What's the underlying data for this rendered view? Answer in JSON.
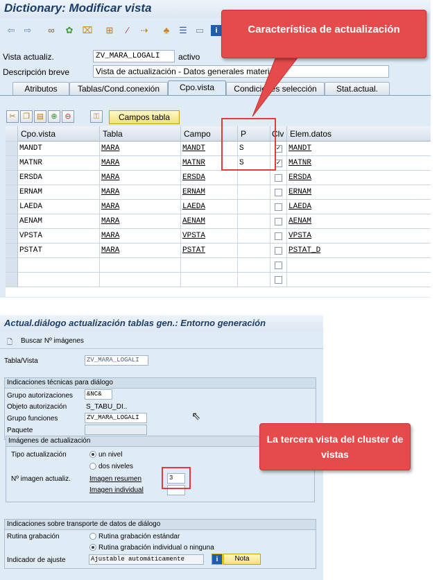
{
  "top_window": {
    "title": "Dictionary: Modificar vista",
    "fields": {
      "vista_label": "Vista actualiz.",
      "vista_value": "ZV_MARA_LOGALI",
      "vista_status": "activo",
      "desc_label": "Descripción breve",
      "desc_value": "Vista de actualización - Datos generales material"
    },
    "tabs": [
      "Atributos",
      "Tablas/Cond.conexión",
      "Cpo.vista",
      "Condiciones selección",
      "Stat.actual."
    ],
    "campos_tabla_button": "Campos tabla",
    "grid": {
      "headers": [
        "Cpo.vista",
        "Tabla",
        "Campo",
        "P",
        "Clv",
        "Elem.datos"
      ],
      "rows": [
        {
          "cpo": "MANDT",
          "tabla": "MARA",
          "campo": "MANDT",
          "p": "S",
          "clv": true,
          "elem": "MANDT"
        },
        {
          "cpo": "MATNR",
          "tabla": "MARA",
          "campo": "MATNR",
          "p": "S",
          "clv": true,
          "elem": "MATNR"
        },
        {
          "cpo": "ERSDA",
          "tabla": "MARA",
          "campo": "ERSDA",
          "p": "",
          "clv": false,
          "elem": "ERSDA"
        },
        {
          "cpo": "ERNAM",
          "tabla": "MARA",
          "campo": "ERNAM",
          "p": "",
          "clv": false,
          "elem": "ERNAM"
        },
        {
          "cpo": "LAEDA",
          "tabla": "MARA",
          "campo": "LAEDA",
          "p": "",
          "clv": false,
          "elem": "LAEDA"
        },
        {
          "cpo": "AENAM",
          "tabla": "MARA",
          "campo": "AENAM",
          "p": "",
          "clv": false,
          "elem": "AENAM"
        },
        {
          "cpo": "VPSTA",
          "tabla": "MARA",
          "campo": "VPSTA",
          "p": "",
          "clv": false,
          "elem": "VPSTA"
        },
        {
          "cpo": "PSTAT",
          "tabla": "MARA",
          "campo": "PSTAT",
          "p": "",
          "clv": false,
          "elem": "PSTAT_D"
        }
      ]
    }
  },
  "callout_top": "Característica de actualización",
  "bottom_window": {
    "title": "Actual.diálogo actualización tablas gen.: Entorno generación",
    "buscar_button": "Buscar Nº imágenes",
    "tabla_vista_label": "Tabla/Vista",
    "tabla_vista_value": "ZV_MARA_LOGALI",
    "tech_group": {
      "header": "Indicaciones técnicas para diálogo",
      "grupo_aut_label": "Grupo autorizaciones",
      "grupo_aut_value": "&NC&",
      "objeto_aut_label": "Objeto autorización",
      "objeto_aut_value": "S_TABU_DI..",
      "grupo_func_label": "Grupo funciones",
      "grupo_func_value": "ZV_MARA_LOGALI",
      "paquete_label": "Paquete",
      "paquete_value": ""
    },
    "images_group": {
      "header": "Imágenes de actualización",
      "tipo_label": "Tipo actualización",
      "opt_un_nivel": "un nivel",
      "opt_dos_niveles": "dos niveles",
      "num_label": "Nº imagen actualiz.",
      "resumen_label": "Imagen resumen",
      "resumen_value": "3",
      "individual_label": "Imagen individual",
      "individual_value": ""
    },
    "transport_group": {
      "header": "Indicaciones sobre transporte de datos de diálogo",
      "rutina_label": "Rutina grabación",
      "opt_estandar": "Rutina grabación estándar",
      "opt_individual": "Rutina grabación individual o ninguna",
      "ajuste_label": "Indicador de ajuste",
      "ajuste_value": "Ajustable automáticamente",
      "nota_button": "Nota"
    }
  },
  "callout_bottom": "La tercera vista del cluster de vistas",
  "icons": [
    "back-arrow-icon",
    "forward-arrow-icon",
    "glasses-icon",
    "objects-icon",
    "lock-icon",
    "hierarchy-icon",
    "magic-wand-icon",
    "navigate-icon",
    "tree-icon",
    "list-icon",
    "layout-icon",
    "info-icon",
    "scissors-icon",
    "copy-icon",
    "paste-icon",
    "insert-row-icon",
    "delete-row-icon",
    "key-icon",
    "document-icon",
    "cursor-icon"
  ]
}
